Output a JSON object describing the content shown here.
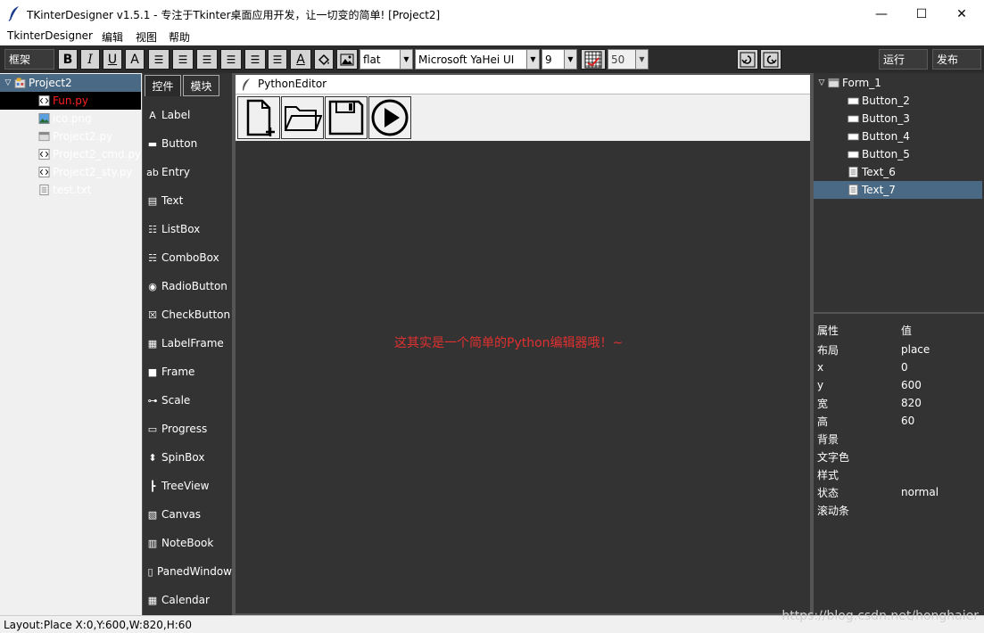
{
  "window": {
    "title": "TKinterDesigner v1.5.1 - 专注于Tkinter桌面应用开发，让一切变的简单!    [Project2]",
    "minimize": "—",
    "maximize": "☐",
    "close": "✕"
  },
  "menu": [
    "TkinterDesigner",
    "编辑",
    "视图",
    "帮助"
  ],
  "toolbar": {
    "frame_label": "框架",
    "font_style": "flat",
    "font_family": "Microsoft YaHei UI",
    "font_size": "9",
    "grid_size": "50",
    "run_label": "运行",
    "publish_label": "发布"
  },
  "project_tree": {
    "root": "Project2",
    "files": [
      {
        "name": "Fun.py",
        "type": "code",
        "active": true
      },
      {
        "name": "ico.png",
        "type": "image",
        "active": false
      },
      {
        "name": "Project2.py",
        "type": "form",
        "active": false
      },
      {
        "name": "Project2_cmd.py",
        "type": "code",
        "active": false
      },
      {
        "name": "Project2_sty.py",
        "type": "code",
        "active": false
      },
      {
        "name": "test.txt",
        "type": "text",
        "active": false
      }
    ]
  },
  "tool_tabs": [
    "控件",
    "模块"
  ],
  "widgets": [
    {
      "label": "Label",
      "icon": "A"
    },
    {
      "label": "Button",
      "icon": "▬"
    },
    {
      "label": "Entry",
      "icon": "ab"
    },
    {
      "label": "Text",
      "icon": "▤"
    },
    {
      "label": "ListBox",
      "icon": "☷"
    },
    {
      "label": "ComboBox",
      "icon": "☵"
    },
    {
      "label": "RadioButton",
      "icon": "◉"
    },
    {
      "label": "CheckButton",
      "icon": "☒"
    },
    {
      "label": "LabelFrame",
      "icon": "▦"
    },
    {
      "label": "Frame",
      "icon": "■"
    },
    {
      "label": "Scale",
      "icon": "⊶"
    },
    {
      "label": "Progress",
      "icon": "▭"
    },
    {
      "label": "SpinBox",
      "icon": "⬍"
    },
    {
      "label": "TreeView",
      "icon": "┣"
    },
    {
      "label": "Canvas",
      "icon": "▧"
    },
    {
      "label": "NoteBook",
      "icon": "▥"
    },
    {
      "label": "PanedWindow",
      "icon": "▯"
    },
    {
      "label": "Calendar",
      "icon": "▦"
    }
  ],
  "editor": {
    "tab_title": "PythonEditor",
    "message": "这其实是一个简单的Python编辑器哦！~"
  },
  "form_tree": {
    "root": "Form_1",
    "items": [
      {
        "name": "Button_2",
        "selected": false
      },
      {
        "name": "Button_3",
        "selected": false
      },
      {
        "name": "Button_4",
        "selected": false
      },
      {
        "name": "Button_5",
        "selected": false
      },
      {
        "name": "Text_6",
        "selected": false
      },
      {
        "name": "Text_7",
        "selected": true
      }
    ]
  },
  "properties": {
    "header": [
      "属性",
      "值"
    ],
    "rows": [
      {
        "key": "布局",
        "value": "place"
      },
      {
        "key": "x",
        "value": "0"
      },
      {
        "key": "y",
        "value": "600"
      },
      {
        "key": "宽",
        "value": "820"
      },
      {
        "key": "高",
        "value": "60"
      },
      {
        "key": "背景",
        "value": ""
      },
      {
        "key": "文字色",
        "value": ""
      },
      {
        "key": "样式",
        "value": ""
      },
      {
        "key": "状态",
        "value": "normal"
      },
      {
        "key": "滚动条",
        "value": ""
      }
    ]
  },
  "status": "Layout:Place   X:0,Y:600,W:820,H:60",
  "watermark": "https://blog.csdn.net/honghaier",
  "colors": {
    "panel_bg": "#333333",
    "selection": "#4a6984",
    "active_file": "#ff2020",
    "editor_message": "#e03030"
  }
}
